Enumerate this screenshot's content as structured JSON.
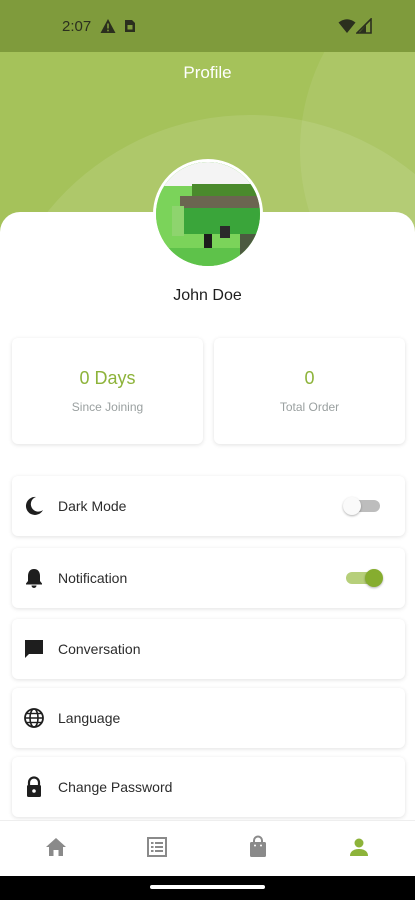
{
  "status_bar": {
    "time": "2:07"
  },
  "header": {
    "title": "Profile"
  },
  "profile": {
    "name": "John Doe"
  },
  "stats": [
    {
      "value": "0 Days",
      "label": "Since Joining"
    },
    {
      "value": "0",
      "label": "Total Order"
    }
  ],
  "settings": [
    {
      "label": "Dark Mode",
      "icon": "moon-icon",
      "toggle": "off"
    },
    {
      "label": "Notification",
      "icon": "bell-icon",
      "toggle": "on"
    },
    {
      "label": "Conversation",
      "icon": "chat-icon"
    },
    {
      "label": "Language",
      "icon": "globe-icon"
    },
    {
      "label": "Change Password",
      "icon": "lock-icon"
    }
  ],
  "bottom_nav": [
    {
      "icon": "home-icon",
      "active": false
    },
    {
      "icon": "orders-list-icon",
      "active": false
    },
    {
      "icon": "shopping-bag-icon",
      "active": false
    },
    {
      "icon": "profile-icon",
      "active": true
    }
  ],
  "colors": {
    "brand": "#a5c25a",
    "accent": "#8db33a",
    "status_bar": "#7f9b3c"
  }
}
